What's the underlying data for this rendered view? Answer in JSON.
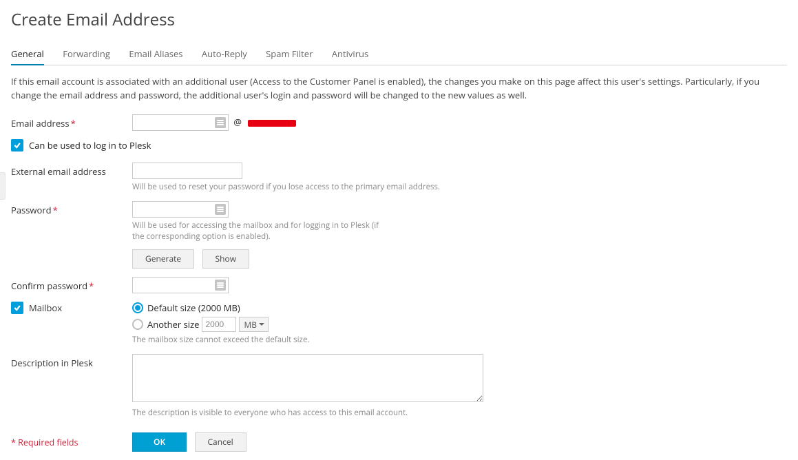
{
  "title": "Create Email Address",
  "tabs": [
    "General",
    "Forwarding",
    "Email Aliases",
    "Auto-Reply",
    "Spam Filter",
    "Antivirus"
  ],
  "active_tab": 0,
  "intro": "If this email account is associated with an additional user (Access to the Customer Panel is enabled), the changes you make on this page affect this user's settings. Particularly, if you change the email address and password, the additional user's login and password will be changed to the new values as well.",
  "labels": {
    "email": "Email address",
    "login_cb": "Can be used to log in to Plesk",
    "ext_email": "External email address",
    "password": "Password",
    "confirm": "Confirm password",
    "mailbox": "Mailbox",
    "desc": "Description in Plesk",
    "required": "* Required fields"
  },
  "email_field": {
    "value": "",
    "at": "@",
    "domain_redacted": true
  },
  "login_checked": true,
  "external_email": {
    "value": "",
    "hint": "Will be used to reset your password if you lose access to the primary email address."
  },
  "password": {
    "value": "",
    "hint": "Will be used for accessing the mailbox and for logging in to Plesk (if the corresponding option is enabled).",
    "generate": "Generate",
    "show": "Show"
  },
  "confirm": {
    "value": ""
  },
  "mailbox": {
    "checked": true,
    "default_label": "Default size (2000 MB)",
    "another_label": "Another size",
    "another_value": "2000",
    "unit": "MB",
    "selected": "default",
    "hint": "The mailbox size cannot exceed the default size."
  },
  "description": {
    "value": "",
    "hint": "The description is visible to everyone who has access to this email account."
  },
  "buttons": {
    "ok": "OK",
    "cancel": "Cancel"
  }
}
